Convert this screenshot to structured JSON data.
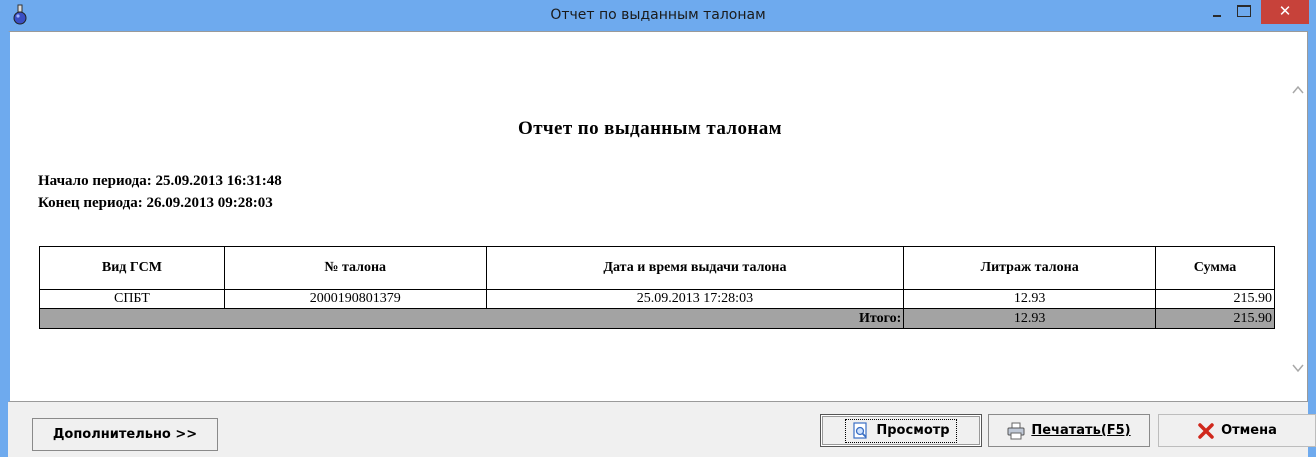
{
  "window": {
    "title": "Отчет по выданным талонам",
    "close_glyph": "✕",
    "icons": [
      "app-flask-icon",
      "minimize-icon",
      "maximize-icon",
      "close-icon"
    ]
  },
  "report": {
    "title": "Отчет по выданным талонам",
    "period_start": "Начало периода: 25.09.2013 16:31:48",
    "period_end": "Конец периода: 26.09.2013 09:28:03",
    "columns": [
      "Вид ГСМ",
      "№ талона",
      "Дата и время выдачи талона",
      "Литраж талона",
      "Сумма"
    ],
    "rows": [
      {
        "fuel": "СПБТ",
        "ticket": "2000190801379",
        "datetime": "25.09.2013 17:28:03",
        "liters": "12.93",
        "sum": "215.90"
      }
    ],
    "total": {
      "label": "Итого:",
      "liters": "12.93",
      "sum": "215.90"
    }
  },
  "buttons": {
    "more": "Дополнительно >>",
    "preview": "Просмотр",
    "print": "Печатать(F5)",
    "cancel": "Отмена"
  },
  "colors": {
    "titlebar": "#6eaaee",
    "close_button": "#c7423a",
    "total_row": "#a3a3a3",
    "cancel_icon": "#d0281c"
  }
}
